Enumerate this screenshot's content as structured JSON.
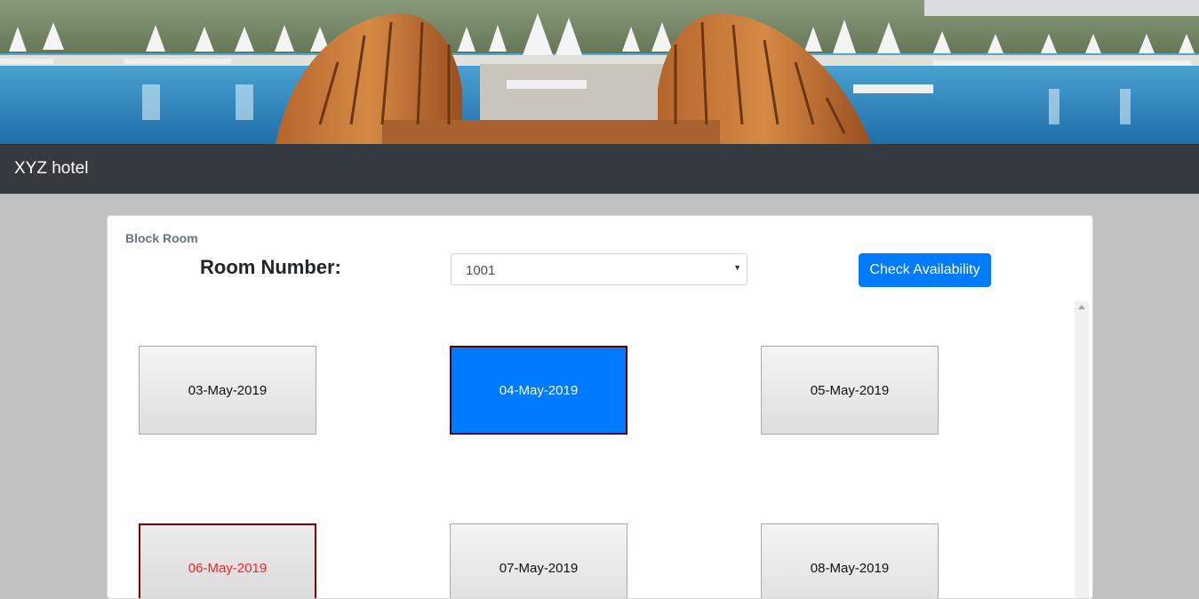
{
  "navbar": {
    "brand": "XYZ hotel"
  },
  "card": {
    "title": "Block Room",
    "room_number_label": "Room Number:",
    "room_select": {
      "selected": "1001"
    },
    "check_button": "Check Availability"
  },
  "dates": [
    {
      "label": "03-May-2019",
      "state": "normal"
    },
    {
      "label": "04-May-2019",
      "state": "selected"
    },
    {
      "label": "05-May-2019",
      "state": "normal"
    },
    {
      "label": "06-May-2019",
      "state": "blocked"
    },
    {
      "label": "07-May-2019",
      "state": "normal"
    },
    {
      "label": "08-May-2019",
      "state": "normal"
    }
  ],
  "colors": {
    "navbar": "#343a40",
    "primary": "#007bff",
    "blocked_text": "#ff2020",
    "page_bg": "#c0c0c0"
  }
}
